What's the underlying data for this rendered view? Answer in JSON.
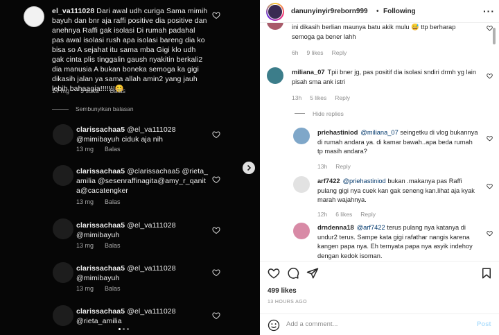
{
  "left_panel": {
    "main_comment": {
      "username": "el_va111028",
      "text": " Dari awal  udh curiga Sama mimih bayuh dan bnr aja raffi positive dia positive dan anehnya Raffi gak isolasi Di rumah padahal pas awal isolasi rush apa isolasi bareng dia ko bisa so A sejahat itu sama mba Gigi klo udh gak cinta plis tinggalin gaush nyakitin berkali2 dia manusia A  bukan  boneka semoga ka gigi dikasih jalan ya sama allah amin2 yang jauh lebih bahaagia!!!!!!!😊",
      "time": "14 mg",
      "likes": "3 suka",
      "reply": "Balas"
    },
    "hide_replies": "Sembunyikan balasan",
    "replies": [
      {
        "username": "clarissachaa5",
        "text": " @el_va111028 @mimibayuh ciduk aja nih",
        "time": "13 mg",
        "reply": "Balas"
      },
      {
        "username": "clarissachaa5",
        "text": " @clarissachaa5 @rieta_amilia @sesenraffinagita@amy_r_qanita@cacatengker",
        "time": "13 mg",
        "reply": "Balas"
      },
      {
        "username": "clarissachaa5",
        "text": " @el_va111028 @mimibayuh",
        "time": "13 mg",
        "reply": "Balas"
      },
      {
        "username": "clarissachaa5",
        "text": " @el_va111028 @mimibayuh",
        "time": "13 mg",
        "reply": "Balas"
      },
      {
        "username": "clarissachaa5",
        "text": " @el_va111028 @rieta_amilia",
        "time": "13 mg",
        "reply": "Balas"
      }
    ]
  },
  "header": {
    "username": "danunyinyir9reborn999",
    "dot": "•",
    "follow_status": "Following",
    "more": "···"
  },
  "comments": {
    "top_partial": {
      "text": "ini dikasih berlian maunya batu akik mulu 😅 ttp berharap semoga ga bener lahh",
      "time": "6h",
      "likes": "9 likes",
      "reply": "Reply"
    },
    "miliana": {
      "username": "miliana_07",
      "text": "Tpii bner jg, pas positif dia isolasi sndiri drmh yg lain pisah sma ank istri",
      "time": "13h",
      "likes": "5 likes",
      "reply": "Reply"
    },
    "hide_replies": "Hide replies",
    "replies": [
      {
        "username": "priehastiniod",
        "mention": "@miliana_07",
        "text": " seingetku di vlog bukannya di rumah andara ya. di kamar bawah..apa beda rumah tp masih andara?",
        "time": "13h",
        "likes": "",
        "reply": "Reply"
      },
      {
        "username": "arf7422",
        "mention": "@priehastiniod",
        "text": " bukan .makanya pas Raffi pulang gigi nya cuek kan gak seneng kan.lihat aja kyak marah wajahnya.",
        "time": "12h",
        "likes": "6 likes",
        "reply": "Reply"
      },
      {
        "username": "drndenna18",
        "mention": "@arf7422",
        "text": " terus pulang nya katanya di undur2 terus. Sampe kata gigi rafathar nangis karena kangen papa nya. Eh ternyata papa nya asyik indehoy dengan kedok isoman.",
        "time": "",
        "likes": "",
        "reply": ""
      }
    ]
  },
  "footer": {
    "likes": "499 likes",
    "timestamp": "13 HOURS AGO",
    "comment_placeholder": "Add a comment...",
    "post_label": "Post"
  }
}
